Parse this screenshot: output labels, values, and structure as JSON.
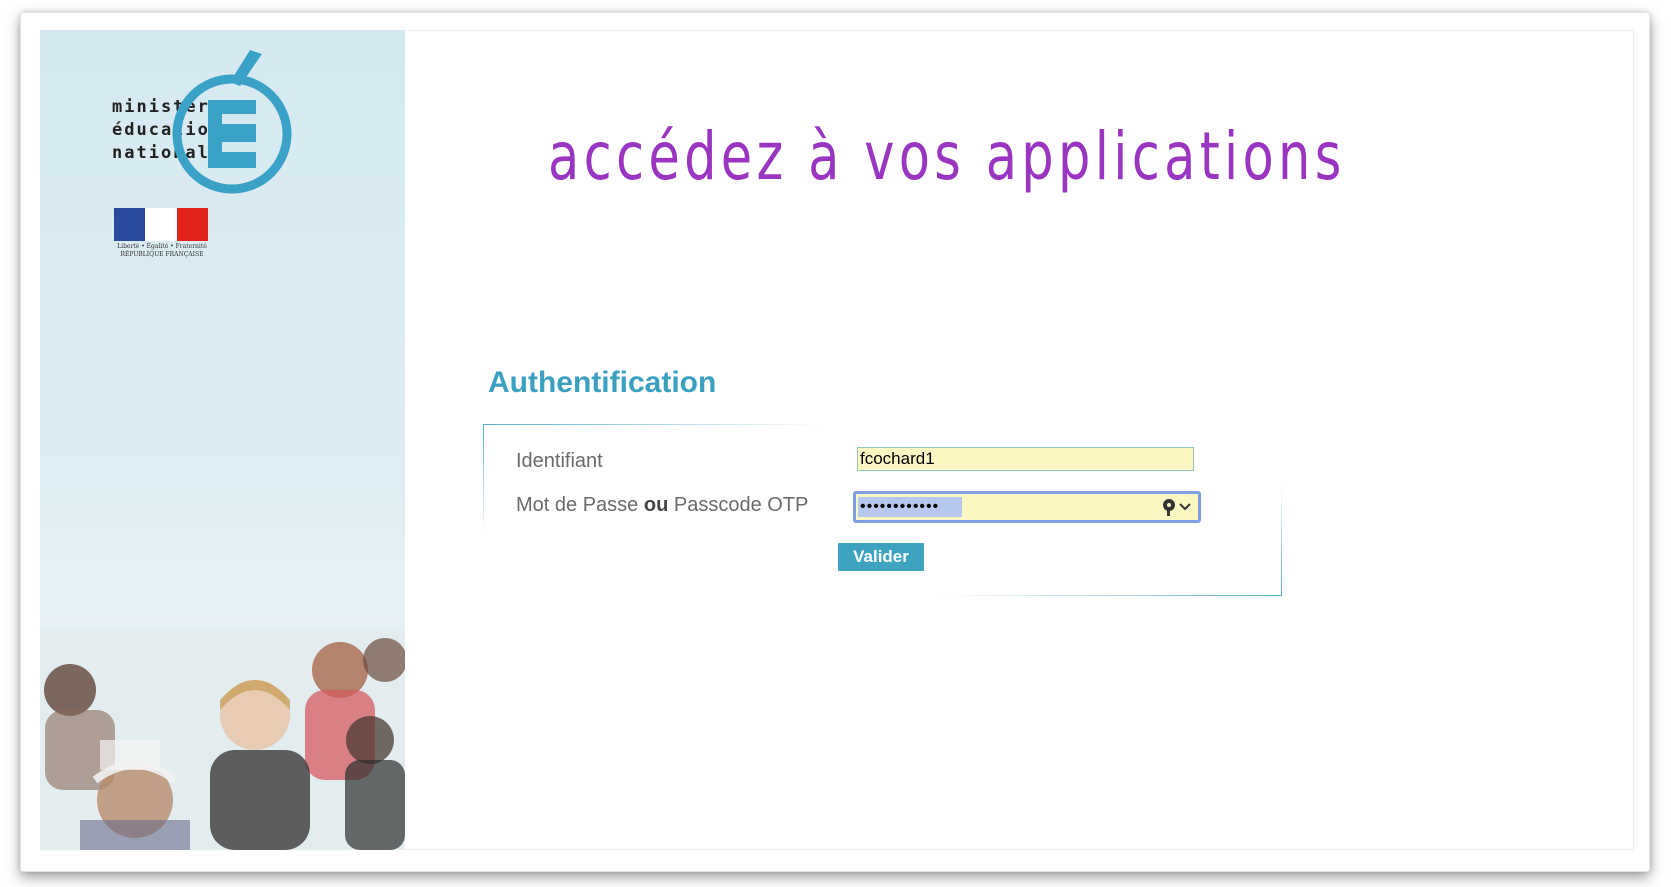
{
  "branding": {
    "ministry_lines": [
      "ministère",
      "éducation",
      "nationale"
    ],
    "logo_letter": "É",
    "republic_caption_motto": "Liberté • Égalité • Fraternité",
    "republic_caption_name": "RÉPUBLIQUE FRANÇAISE"
  },
  "header": {
    "title": "accédez à vos applications"
  },
  "auth": {
    "title": "Authentification",
    "identifiant_label": "Identifiant",
    "identifiant_value": "fcochard1",
    "password_label_prefix": "Mot de Passe",
    "password_label_or": "ou",
    "password_label_suffix": "Passcode OTP",
    "password_value": "••••••••••••",
    "submit_label": "Valider"
  },
  "colors": {
    "title_purple": "#9a35c2",
    "accent_blue": "#3ea3bf",
    "logo_blue": "#3aa2c6",
    "autofill_yellow": "#fbf7c3"
  },
  "icons": {
    "password_manager": "key-icon",
    "dropdown": "chevron-down-icon"
  }
}
